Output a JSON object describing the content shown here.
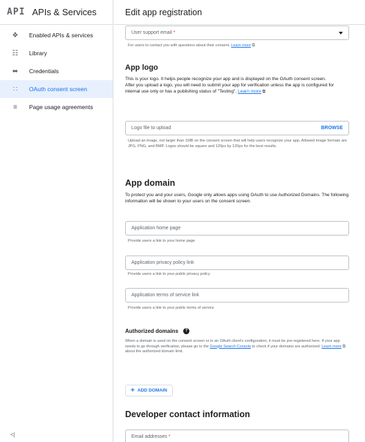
{
  "sidebar": {
    "logo": "API",
    "title": "APIs & Services",
    "items": [
      {
        "label": "Enabled APIs & services",
        "icon": "enabled-apis-icon",
        "glyph": "❖"
      },
      {
        "label": "Library",
        "icon": "library-icon",
        "glyph": "☷"
      },
      {
        "label": "Credentials",
        "icon": "key-icon",
        "glyph": "⬌"
      },
      {
        "label": "OAuth consent screen",
        "icon": "consent-icon",
        "glyph": "∷"
      },
      {
        "label": "Page usage agreements",
        "icon": "settings-list-icon",
        "glyph": "≡"
      }
    ],
    "active_index": 3,
    "collapse_label": "<|"
  },
  "header": {
    "title": "Edit app registration"
  },
  "form": {
    "support_email": {
      "placeholder": "User support email",
      "required": "*",
      "helper": "For users to contact you with questions about their consent.",
      "learn_more": "Learn more"
    },
    "app_logo": {
      "heading": "App logo",
      "para1": "This is your logo. It helps people recognize your app and is displayed on the OAuth consent screen.",
      "para2": "After you upload a logo, you will need to submit your app for verification unless the app is configured for internal use only or has a publishing status of \"Testing\".",
      "learn_more": "Learn more",
      "file_placeholder": "Logo file to upload",
      "browse": "BROWSE",
      "file_helper": "Upload an image, not larger than 1MB on the consent screen that will help users recognize your app. Allowed image formats are JPG, PNG, and BMP. Logos should be square and 120px by 120px for the best results."
    },
    "app_domain": {
      "heading": "App domain",
      "para": "To protect you and your users, Google only allows apps using OAuth to use Authorized Domains. The following information will be shown to your users on the consent screen.",
      "home_page": {
        "placeholder": "Application home page",
        "helper": "Provide users a link to your home page"
      },
      "privacy": {
        "placeholder": "Application privacy policy link",
        "helper": "Provide users a link to your public privacy policy"
      },
      "terms": {
        "placeholder": "Application terms of service link",
        "helper": "Provide users a link to your public terms of service"
      }
    },
    "authorized_domains": {
      "heading": "Authorized domains",
      "para_a": "When a domain is used on the consent screen or in an OAuth client's configuration, it must be pre-registered here. If your app needs to go through verification, please go to the",
      "search_console": "Google Search Console",
      "para_b": "to check if your domains are authorized.",
      "learn_more": "Learn more",
      "para_c": "about the authorized domain limit.",
      "add_button": "ADD DOMAIN"
    },
    "developer_contact": {
      "heading": "Developer contact information",
      "email_placeholder": "Email addresses",
      "required": "*"
    }
  }
}
